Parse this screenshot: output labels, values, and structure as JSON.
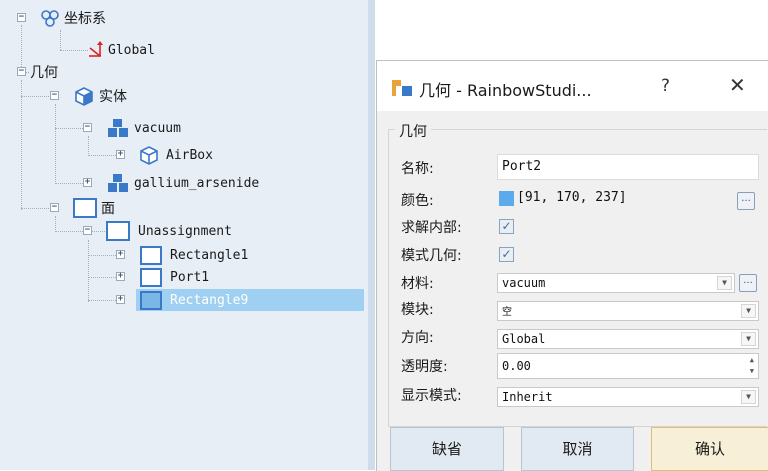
{
  "tree": {
    "coord_system": "坐标系",
    "global": "Global",
    "geometry": "几何",
    "solids": "实体",
    "vacuum": "vacuum",
    "airbox": "AirBox",
    "gallium_arsenide": "gallium_arsenide",
    "faces": "面",
    "unassignment": "Unassignment",
    "rectangle1": "Rectangle1",
    "port1": "Port1",
    "rectangle9": "Rectangle9",
    "expand_symbol": "+",
    "collapse_symbol": "−"
  },
  "dialog": {
    "title": "几何 - RainbowStudi...",
    "help": "?",
    "close": "✕",
    "group_title": "几何",
    "fields": {
      "name_label": "名称:",
      "name_value": "Port2",
      "color_label": "颜色:",
      "color_value": "[91, 170, 237]",
      "color_hex": "#5baaed",
      "solve_inside_label": "求解内部:",
      "model_geom_label": "模式几何:",
      "material_label": "材料:",
      "material_value": "vacuum",
      "block_label": "模块:",
      "block_value": "空",
      "direction_label": "方向:",
      "direction_value": "Global",
      "transparency_label": "透明度:",
      "transparency_value": "0.00",
      "display_mode_label": "显示模式:",
      "display_mode_value": "Inherit"
    },
    "buttons": {
      "default": "缺省",
      "cancel": "取消",
      "ok": "确认"
    },
    "dots": "...",
    "checkmark": "✓",
    "dropdown_arrow": "▼",
    "spin_up": "▲",
    "spin_down": "▼"
  },
  "colors": {
    "tree_bg": "#e8eef6",
    "selection": "#9fd0f2",
    "icon_blue": "#3a78c8",
    "dialog_body": "#f0f0f0"
  }
}
